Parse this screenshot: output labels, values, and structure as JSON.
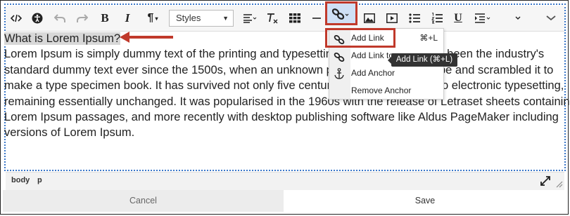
{
  "toolbar": {
    "styles_label": "Styles",
    "icons": [
      "code-view-icon",
      "accessibility-icon",
      "undo-icon",
      "redo-icon",
      "bold-icon",
      "italic-icon",
      "paragraph-icon",
      "align-icon",
      "clear-format-icon",
      "table-icon",
      "horizontal-rule-icon",
      "link-icon",
      "image-icon",
      "video-icon",
      "bullet-list-icon",
      "numbered-list-icon",
      "underline-icon",
      "indent-icon",
      "more-icon",
      "collapse-icon"
    ]
  },
  "content": {
    "heading": "What is Lorem Ipsum?",
    "para_lines": [
      "Lorem Ipsum is simply dummy text of the printing and typesetting",
      "standard dummy text ever since the 1500s, when an unknown pri",
      "make a type specimen book. It has survived not only five centurie",
      "remaining essentially unchanged. It was popularised in the 1960s with the release of Letraset sheets containing",
      "Lorem Ipsum passages, and more recently with desktop publishing software like Aldus PageMaker including",
      "versions of Lorem Ipsum."
    ],
    "para_tails": [
      "has been the industry's",
      "be and scrambled it to",
      "o electronic typesetting,"
    ]
  },
  "link_menu": {
    "items": [
      {
        "label": "Add Link",
        "shortcut": "⌘+L"
      },
      {
        "label": "Add Link to",
        "shortcut": ""
      },
      {
        "label": "Add Anchor",
        "shortcut": ""
      },
      {
        "label": "Remove Anchor",
        "shortcut": ""
      }
    ],
    "tooltip": "Add Link (⌘+L)"
  },
  "statusbar": {
    "path": [
      "body",
      "p"
    ]
  },
  "buttons": {
    "cancel": "Cancel",
    "save": "Save"
  },
  "colors": {
    "highlight_red": "#c0392b",
    "link_button_bg": "#cfe0f5",
    "dotted_border": "#3b78c9"
  }
}
